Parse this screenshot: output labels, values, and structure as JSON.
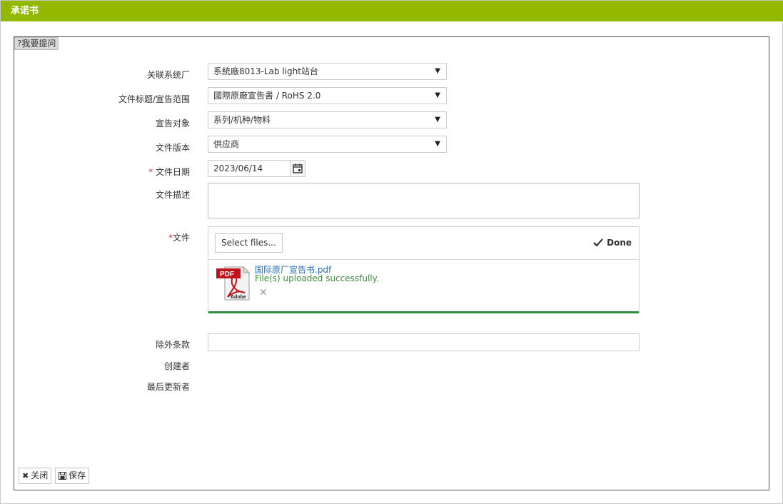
{
  "window": {
    "title": "承诺书"
  },
  "help": {
    "label": "?我要提问"
  },
  "form": {
    "related_system": {
      "label": "关联系统厂",
      "value": "系統廠8013-Lab light站台"
    },
    "doc_title": {
      "label": "文件标题/宣告范围",
      "value": "國際原廠宣告書 / RoHS 2.0"
    },
    "declaration_target": {
      "label": "宣告对象",
      "value": "系列/机种/物料"
    },
    "doc_version": {
      "label": "文件版本",
      "value": "供应商"
    },
    "doc_date": {
      "required_mark": "*",
      "label": "文件日期",
      "value": "2023/06/14"
    },
    "doc_description": {
      "label": "文件描述",
      "value": ""
    },
    "file": {
      "required_mark": "*",
      "label": "文件",
      "select_label": "Select files...",
      "done_label": "Done",
      "file_name": "国际原厂宣告书.pdf",
      "status": "File(s) uploaded successfully.",
      "progress": 1.0,
      "icon": "pdf-file-icon",
      "icon_text_top": "PDF",
      "icon_text_bottom": "Adobe"
    },
    "exclusion": {
      "label": "除外条款",
      "value": ""
    },
    "creator": {
      "label": "创建者",
      "value": ""
    },
    "last_updater": {
      "label": "最后更新者",
      "value": ""
    }
  },
  "buttons": {
    "close": {
      "label": "关闭",
      "icon": "close-icon"
    },
    "save": {
      "label": "保存",
      "icon": "save-icon"
    }
  },
  "colors": {
    "title_bar": "#93b800",
    "progress": "#2e8b3e",
    "required": "#d9302c",
    "link": "#2a6fb3",
    "success": "#3b8f3b"
  }
}
